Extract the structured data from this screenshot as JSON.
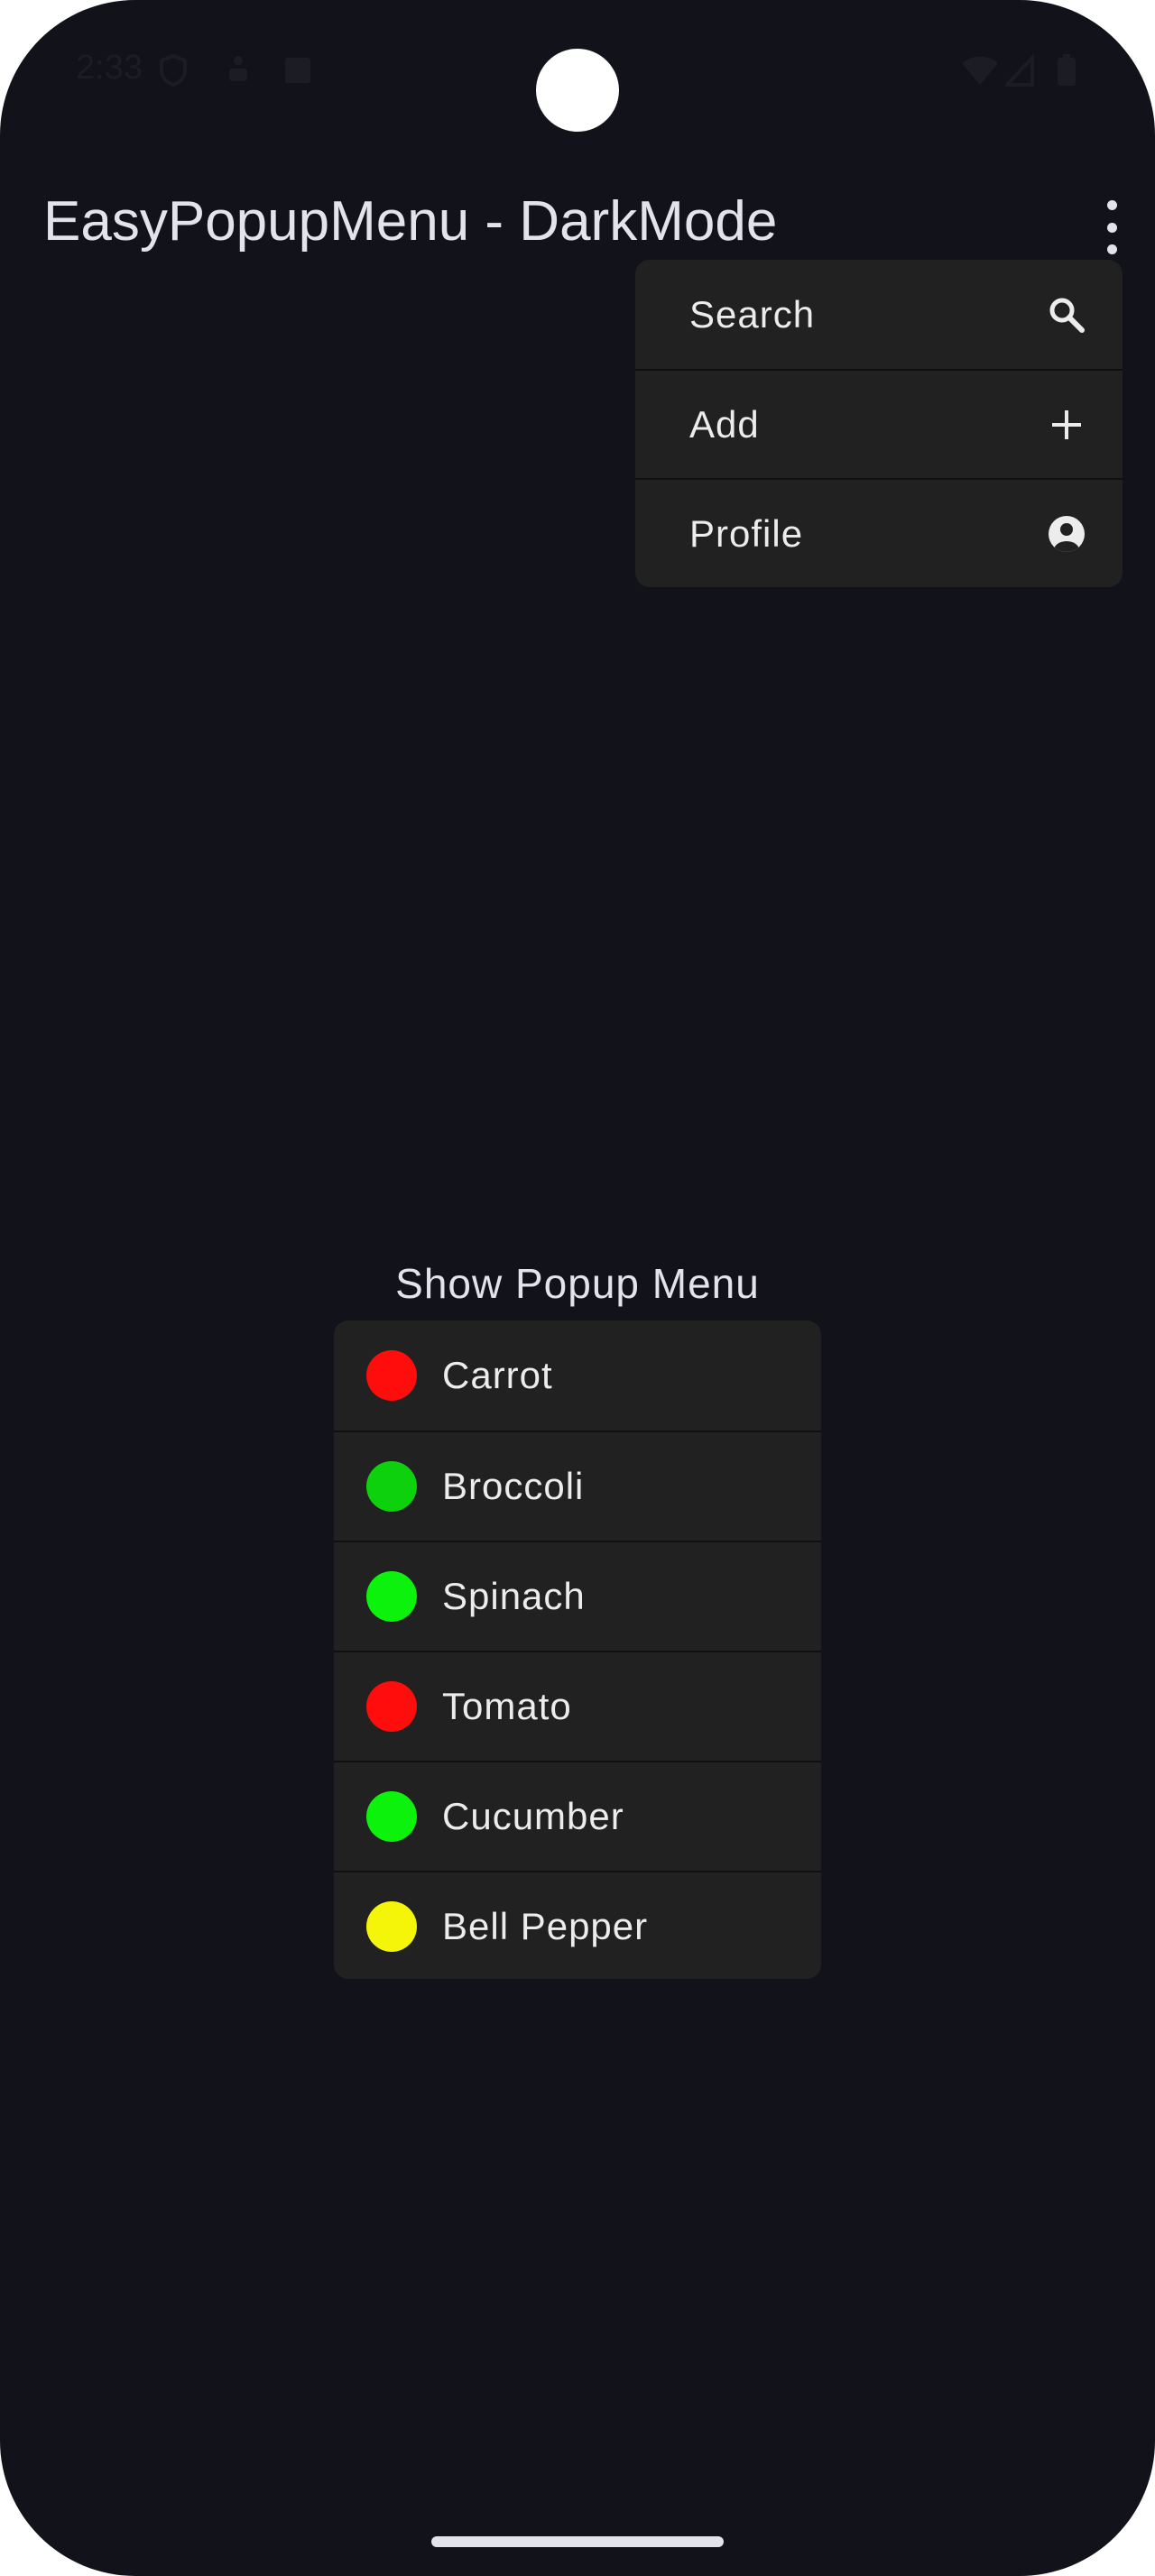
{
  "status_bar": {
    "time": "2:33",
    "left_icons": [
      "shield-icon",
      "accessibility-icon",
      "text-icon"
    ],
    "right_icons": [
      "wifi-icon",
      "signal-icon",
      "battery-icon"
    ]
  },
  "app_bar": {
    "title": "EasyPopupMenu - DarkMode",
    "overflow_icon": "more-vert-icon"
  },
  "top_menu": {
    "items": [
      {
        "label": "Search",
        "icon": "search-icon"
      },
      {
        "label": "Add",
        "icon": "plus-icon"
      },
      {
        "label": "Profile",
        "icon": "account-circle-icon"
      }
    ]
  },
  "main": {
    "show_popup_label": "Show Popup Menu"
  },
  "veg_menu": {
    "items": [
      {
        "label": "Carrot",
        "color": "#ff0d0d"
      },
      {
        "label": "Broccoli",
        "color": "#0ed10e"
      },
      {
        "label": "Spinach",
        "color": "#0df20d"
      },
      {
        "label": "Tomato",
        "color": "#ff0d0d"
      },
      {
        "label": "Cucumber",
        "color": "#0df20d"
      },
      {
        "label": "Bell Pepper",
        "color": "#f5f50a"
      }
    ]
  },
  "colors": {
    "background": "#12131a",
    "menu_surface": "#212121",
    "text": "#ececec"
  }
}
